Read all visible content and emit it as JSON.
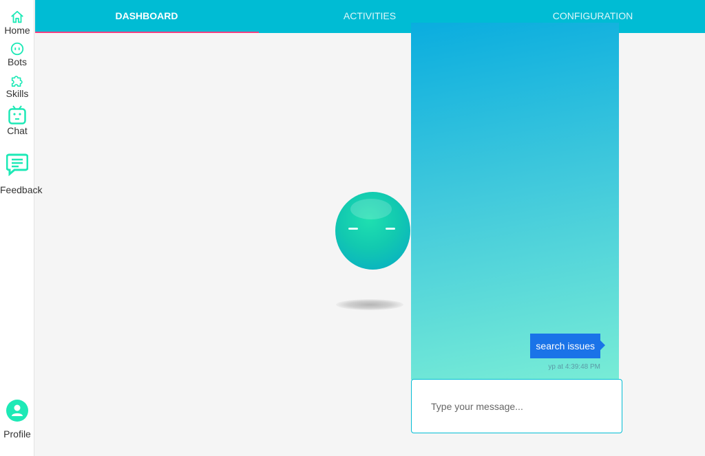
{
  "sidebar": {
    "items": [
      {
        "label": "Home",
        "icon": "home-icon"
      },
      {
        "label": "Bots",
        "icon": "bot-face-icon"
      },
      {
        "label": "Skills",
        "icon": "puzzle-icon"
      },
      {
        "label": "Chat",
        "icon": "tv-bot-icon"
      },
      {
        "label": "Feedback",
        "icon": "feedback-icon"
      }
    ],
    "profile": {
      "label": "Profile",
      "icon": "person-icon"
    }
  },
  "tabs": [
    {
      "label": "DASHBOARD",
      "active": true
    },
    {
      "label": "ACTIVITIES",
      "active": false
    },
    {
      "label": "CONFIGURATION",
      "active": false
    }
  ],
  "chat": {
    "messages": [
      {
        "text": "search issues",
        "meta": "yp at 4:39:48 PM"
      }
    ],
    "input_placeholder": "Type your message..."
  },
  "colors": {
    "topbar": "#00bcd4",
    "tab_indicator": "#ff4081",
    "icon_accent": "#1de9b6",
    "message_bubble": "#1a73e8"
  }
}
